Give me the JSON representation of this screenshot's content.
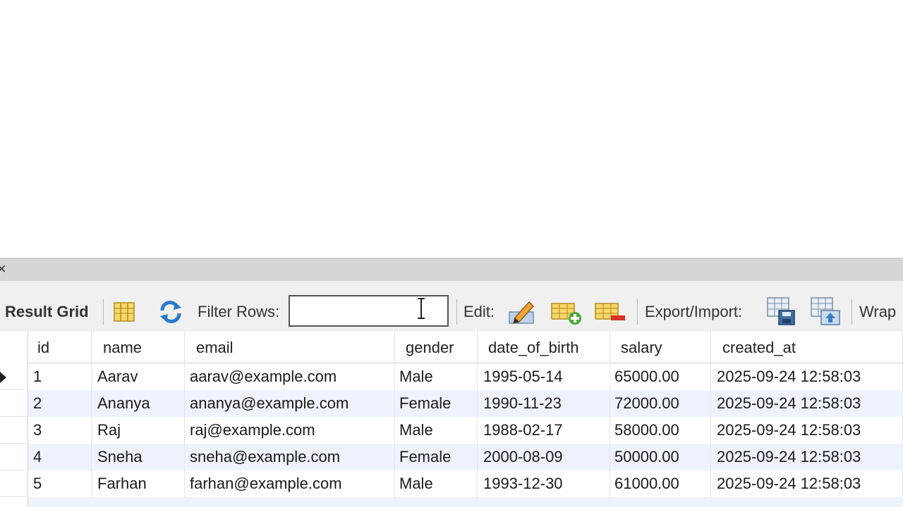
{
  "toolbar": {
    "result_grid_label": "Result Grid",
    "filter_label": "Filter Rows:",
    "filter_value": "",
    "edit_label": "Edit:",
    "export_label": "Export/Import:",
    "wrap_label": "Wrap"
  },
  "grid": {
    "columns": [
      "id",
      "name",
      "email",
      "gender",
      "date_of_birth",
      "salary",
      "created_at"
    ],
    "rows": [
      [
        "1",
        "Aarav",
        "aarav@example.com",
        "Male",
        "1995-05-14",
        "65000.00",
        "2025-09-24 12:58:03"
      ],
      [
        "2",
        "Ananya",
        "ananya@example.com",
        "Female",
        "1990-11-23",
        "72000.00",
        "2025-09-24 12:58:03"
      ],
      [
        "3",
        "Raj",
        "raj@example.com",
        "Male",
        "1988-02-17",
        "58000.00",
        "2025-09-24 12:58:03"
      ],
      [
        "4",
        "Sneha",
        "sneha@example.com",
        "Female",
        "2000-08-09",
        "50000.00",
        "2025-09-24 12:58:03"
      ],
      [
        "5",
        "Farhan",
        "farhan@example.com",
        "Male",
        "1993-12-30",
        "61000.00",
        "2025-09-24 12:58:03"
      ]
    ]
  },
  "colors": {
    "alt_row": "#eef3fb",
    "toolbar_bg": "#f0f0f0",
    "panel_bar": "#d6d6d6"
  },
  "icons": [
    "close-icon",
    "column-toggle-icon",
    "refresh-icon",
    "edit-pencil-icon",
    "add-row-icon",
    "delete-row-icon",
    "export-icon",
    "import-icon",
    "current-row-arrow-icon"
  ]
}
